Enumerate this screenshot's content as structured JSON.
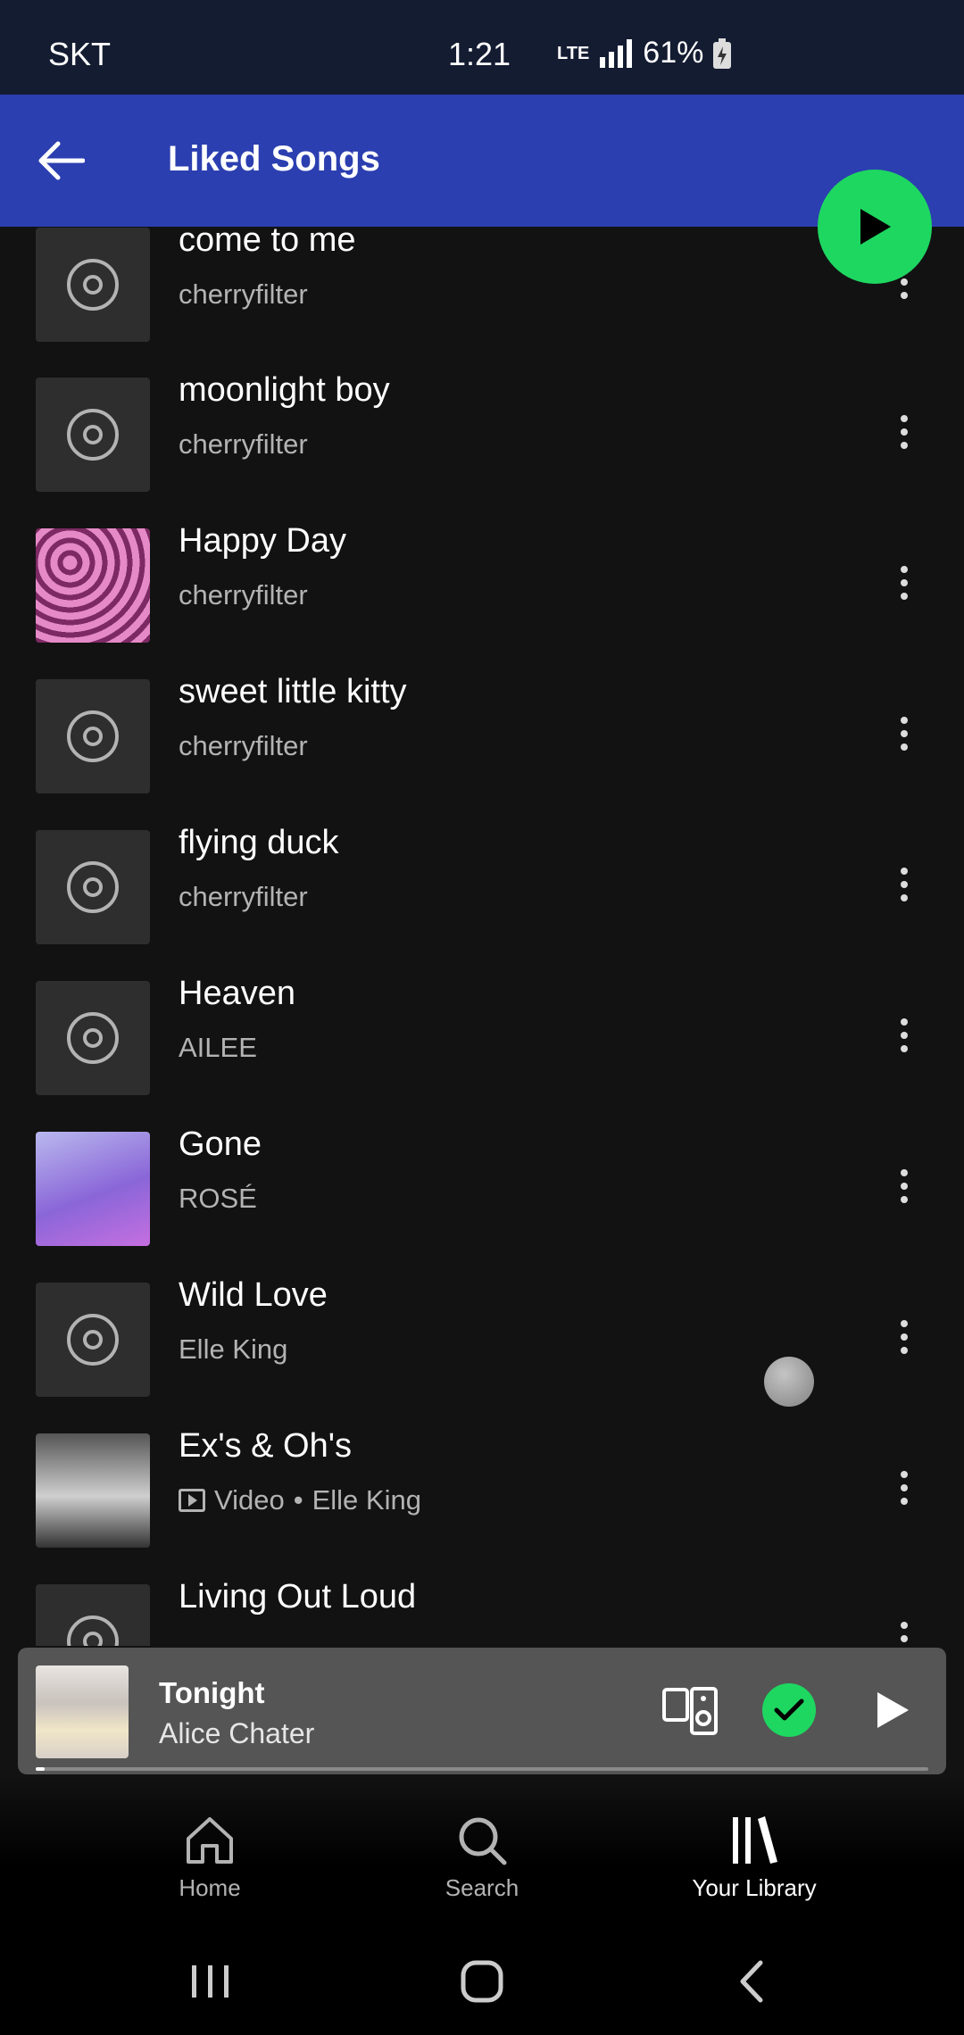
{
  "status_bar": {
    "carrier": "SKT",
    "time": "1:21",
    "network": "LTE",
    "battery": "61%"
  },
  "header": {
    "title": "Liked Songs"
  },
  "songs": [
    {
      "title": "come to me",
      "artist": "cherryfilter",
      "art": "placeholder"
    },
    {
      "title": "moonlight boy",
      "artist": "cherryfilter",
      "art": "placeholder"
    },
    {
      "title": "Happy Day",
      "artist": "cherryfilter",
      "art": "happy"
    },
    {
      "title": "sweet little kitty",
      "artist": "cherryfilter",
      "art": "placeholder"
    },
    {
      "title": "flying duck",
      "artist": "cherryfilter",
      "art": "placeholder"
    },
    {
      "title": "Heaven",
      "artist": "AILEE",
      "art": "placeholder"
    },
    {
      "title": "Gone",
      "artist": "ROSÉ",
      "art": "gone"
    },
    {
      "title": "Wild Love",
      "artist": "Elle King",
      "art": "placeholder"
    },
    {
      "title": "Ex's & Oh's",
      "artist": "Elle King",
      "type_label": "Video",
      "art": "exs"
    },
    {
      "title": "Living Out Loud",
      "artist": "",
      "art": "placeholder"
    }
  ],
  "now_playing": {
    "title": "Tonight",
    "artist": "Alice Chater",
    "progress": 0.01,
    "liked": true
  },
  "bottom_nav": {
    "home": "Home",
    "search": "Search",
    "library": "Your Library",
    "active": "library"
  },
  "colors": {
    "accent": "#1ed760",
    "header_bg": "#2b3fb0",
    "background": "#121212"
  }
}
